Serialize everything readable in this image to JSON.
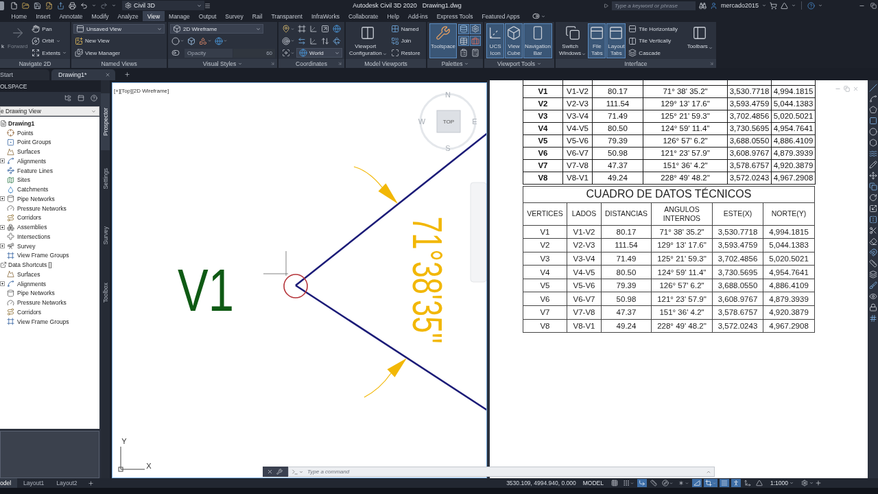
{
  "title_bar": {
    "workspace": "Civil 3D",
    "title": "Autodesk Civil 3D 2020",
    "file_name": "Drawing1.dwg",
    "search": {
      "placeholder": "Type a keyword or phrase"
    },
    "user": "mercado2015"
  },
  "ribbon_tabs": [
    {
      "label": "Home",
      "selected": false
    },
    {
      "label": "Insert",
      "selected": false
    },
    {
      "label": "Annotate",
      "selected": false
    },
    {
      "label": "Modify",
      "selected": false
    },
    {
      "label": "Analyze",
      "selected": false
    },
    {
      "label": "View",
      "selected": true
    },
    {
      "label": "Manage",
      "selected": false
    },
    {
      "label": "Output",
      "selected": false
    },
    {
      "label": "Survey",
      "selected": false
    },
    {
      "label": "Rail",
      "selected": false
    },
    {
      "label": "Transparent",
      "selected": false
    },
    {
      "label": "InfraWorks",
      "selected": false
    },
    {
      "label": "Collaborate",
      "selected": false
    },
    {
      "label": "Help",
      "selected": false
    },
    {
      "label": "Add-ins",
      "selected": false
    },
    {
      "label": "Express Tools",
      "selected": false
    },
    {
      "label": "Featured Apps",
      "selected": false
    }
  ],
  "ribbon_panels": [
    {
      "title": "Navigate 2D",
      "menu": false,
      "launcher": false,
      "groups": [
        {
          "kind": "large",
          "items": [
            {
              "label": "k",
              "disabled": false,
              "selected": false,
              "menu": false
            },
            {
              "label": "Forward",
              "disabled": true,
              "selected": false,
              "menu": false
            }
          ]
        },
        {
          "kind": "stack",
          "rows": [
            [
              {
                "kind": "small",
                "label": "Pan",
                "menu": false
              }
            ],
            [
              {
                "kind": "small",
                "label": "Orbit",
                "menu": true
              }
            ],
            [
              {
                "kind": "small",
                "label": "Extents",
                "menu": true
              }
            ]
          ]
        }
      ]
    },
    {
      "title": "Named Views",
      "menu": false,
      "launcher": false,
      "groups": [
        {
          "kind": "stack",
          "rows": [
            [
              {
                "kind": "dropdown",
                "value": "Unsaved View"
              }
            ],
            [
              {
                "kind": "small",
                "label": "New View",
                "menu": false
              }
            ],
            [
              {
                "kind": "small",
                "label": "View Manager",
                "menu": false
              }
            ]
          ]
        }
      ]
    },
    {
      "title": "Visual Styles",
      "menu": true,
      "launcher": true,
      "groups": [
        {
          "kind": "stack",
          "rows": [
            [
              {
                "kind": "dropdown",
                "value": "2D Wireframe"
              }
            ],
            [
              {
                "kind": "icon",
                "menu": true,
                "selected": false
              },
              {
                "kind": "icon",
                "menu": false,
                "selected": false
              },
              {
                "kind": "icon",
                "menu": true,
                "selected": false
              },
              {
                "kind": "icon",
                "menu": true,
                "selected": false
              }
            ],
            [
              {
                "kind": "icon",
                "menu": false,
                "selected": false
              },
              {
                "kind": "slider",
                "label": "Opacity",
                "value": "60",
                "disabled": true
              }
            ]
          ]
        }
      ]
    },
    {
      "title": "Coordinates",
      "menu": false,
      "launcher": true,
      "groups": [
        {
          "kind": "stack",
          "rows": [
            [
              {
                "kind": "icon",
                "menu": true,
                "selected": false
              },
              {
                "kind": "icon",
                "menu": false,
                "selected": false
              },
              {
                "kind": "icon",
                "menu": false,
                "selected": false
              },
              {
                "kind": "icon",
                "menu": false,
                "selected": false
              },
              {
                "kind": "icon",
                "menu": false,
                "selected": false
              }
            ],
            [
              {
                "kind": "icon",
                "menu": true,
                "selected": false
              },
              {
                "kind": "icon",
                "menu": false,
                "selected": false
              },
              {
                "kind": "icon",
                "menu": false,
                "selected": false
              },
              {
                "kind": "icon",
                "menu": false,
                "selected": false
              },
              {
                "kind": "icon",
                "menu": false,
                "selected": false
              }
            ],
            [
              {
                "kind": "icon",
                "menu": true,
                "selected": false
              },
              {
                "kind": "dropdown",
                "value": "World"
              }
            ]
          ]
        }
      ]
    },
    {
      "title": "Model Viewports",
      "menu": false,
      "launcher": false,
      "groups": [
        {
          "kind": "large",
          "items": [
            {
              "label": "Viewport Configuration",
              "disabled": false,
              "selected": false,
              "menu": true
            }
          ]
        },
        {
          "kind": "stack",
          "rows": [
            [
              {
                "kind": "small",
                "label": "Named",
                "menu": false
              }
            ],
            [
              {
                "kind": "small",
                "label": "Join",
                "menu": false
              }
            ],
            [
              {
                "kind": "small",
                "label": "Restore",
                "menu": false
              }
            ]
          ]
        }
      ]
    },
    {
      "title": "Palettes",
      "menu": true,
      "launcher": false,
      "groups": [
        {
          "kind": "large",
          "items": [
            {
              "label": "Toolspace",
              "disabled": false,
              "selected": true,
              "menu": false
            }
          ]
        },
        {
          "kind": "stack",
          "rows": [
            [
              {
                "kind": "icon",
                "menu": false,
                "selected": true
              },
              {
                "kind": "icon",
                "menu": false,
                "selected": true
              }
            ],
            [
              {
                "kind": "icon",
                "menu": false,
                "selected": true
              },
              {
                "kind": "icon",
                "menu": false,
                "selected": true
              }
            ],
            [
              {
                "kind": "icon",
                "menu": false,
                "selected": false
              },
              {
                "kind": "icon",
                "menu": false,
                "selected": false
              }
            ]
          ]
        }
      ]
    },
    {
      "title": "Viewport Tools",
      "menu": true,
      "launcher": false,
      "groups": [
        {
          "kind": "large",
          "items": [
            {
              "label": "UCS Icon",
              "disabled": false,
              "selected": true,
              "menu": false
            },
            {
              "label": "View Cube",
              "disabled": false,
              "selected": true,
              "menu": false
            },
            {
              "label": "Navigation Bar",
              "disabled": false,
              "selected": true,
              "menu": false
            }
          ]
        }
      ]
    },
    {
      "title": "Interface",
      "menu": false,
      "launcher": true,
      "groups": [
        {
          "kind": "large",
          "items": [
            {
              "label": "Switch Windows",
              "disabled": false,
              "selected": false,
              "menu": true
            },
            {
              "label": "File Tabs",
              "disabled": false,
              "selected": true,
              "menu": false
            },
            {
              "label": "Layout Tabs",
              "disabled": false,
              "selected": true,
              "menu": false
            }
          ]
        },
        {
          "kind": "stack",
          "rows": [
            [
              {
                "kind": "small",
                "label": "Tile Horizontally",
                "menu": false
              }
            ],
            [
              {
                "kind": "small",
                "label": "Tile Vertically",
                "menu": false
              }
            ],
            [
              {
                "kind": "small",
                "label": "Cascade",
                "menu": false
              }
            ]
          ]
        },
        {
          "kind": "large",
          "items": [
            {
              "label": "Toolbars",
              "disabled": false,
              "selected": false,
              "menu": true
            }
          ]
        }
      ]
    }
  ],
  "file_tabs": [
    {
      "label": "Start",
      "selected": false,
      "closable": false
    },
    {
      "label": "Drawing1*",
      "selected": true,
      "closable": true
    }
  ],
  "toolspace": {
    "title": "OLSPACE",
    "view": "e Drawing View",
    "tree": [
      {
        "label": "Drawing1",
        "current": true,
        "children": [
          {
            "label": "Points",
            "collapsed": false
          },
          {
            "label": "Point Groups",
            "collapsed": false
          },
          {
            "label": "Surfaces",
            "collapsed": false
          },
          {
            "label": "Alignments",
            "collapsed": true
          },
          {
            "label": "Feature Lines",
            "collapsed": false
          },
          {
            "label": "Sites",
            "collapsed": false
          },
          {
            "label": "Catchments",
            "collapsed": false
          },
          {
            "label": "Pipe Networks",
            "collapsed": true
          },
          {
            "label": "Pressure Networks",
            "collapsed": false
          },
          {
            "label": "Corridors",
            "collapsed": false
          },
          {
            "label": "Assemblies",
            "collapsed": true
          },
          {
            "label": "Intersections",
            "collapsed": false
          },
          {
            "label": "Survey",
            "collapsed": true
          },
          {
            "label": "View Frame Groups",
            "collapsed": false
          }
        ]
      },
      {
        "label": "Data Shortcuts []",
        "current": false,
        "children": [
          {
            "label": "Surfaces",
            "collapsed": false
          },
          {
            "label": "Alignments",
            "collapsed": true
          },
          {
            "label": "Pipe Networks",
            "collapsed": false
          },
          {
            "label": "Pressure Networks",
            "collapsed": false
          },
          {
            "label": "Corridors",
            "collapsed": false
          },
          {
            "label": "View Frame Groups",
            "collapsed": false
          }
        ]
      }
    ],
    "tabs": [
      {
        "label": "Prospector",
        "selected": true
      },
      {
        "label": "Settings",
        "selected": false
      },
      {
        "label": "Survey",
        "selected": false
      },
      {
        "label": "Toolbox",
        "selected": false
      }
    ]
  },
  "viewport_left": {
    "label": "[+][Top][2D Wireframe]",
    "active": true,
    "view_cube": {
      "north": "N",
      "west": "W",
      "east": "E",
      "south": "S",
      "face": "TOP"
    },
    "ucs": {
      "y": "Y",
      "x": "X"
    },
    "drawing": {
      "vertex_label": "V1",
      "angle_label": "71°38'35\""
    }
  },
  "viewport_right": {
    "top_table": {
      "rows": [
        [
          "V1",
          "V1-V2",
          "80.17",
          "71° 38' 35.2\"",
          "3,530.7718",
          "4,994.1815"
        ],
        [
          "V2",
          "V2-V3",
          "111.54",
          "129° 13' 17.6\"",
          "3,593.4759",
          "5,044.1383"
        ],
        [
          "V3",
          "V3-V4",
          "71.49",
          "125° 21' 59.3\"",
          "3,702.4856",
          "5,020.5021"
        ],
        [
          "V4",
          "V4-V5",
          "80.50",
          "124° 59' 11.4\"",
          "3,730.5695",
          "4,954.7641"
        ],
        [
          "V5",
          "V5-V6",
          "79.39",
          "126° 57' 6.2\"",
          "3,688.0550",
          "4,886.4109"
        ],
        [
          "V6",
          "V6-V7",
          "50.98",
          "121° 23' 57.9\"",
          "3,608.9767",
          "4,879.3939"
        ],
        [
          "V7",
          "V7-V8",
          "47.37",
          "151° 36' 4.2\"",
          "3,578.6757",
          "4,920.3879"
        ],
        [
          "V8",
          "V8-V1",
          "49.24",
          "228° 49' 48.2\"",
          "3,572.0243",
          "4,967.2908"
        ]
      ]
    },
    "table": {
      "title": "CUADRO DE DATOS TÉCNICOS",
      "columns": [
        "VERTICES",
        "LADOS",
        "DISTANCIAS",
        "ANGULOS INTERNOS",
        "ESTE(X)",
        "NORTE(Y)"
      ],
      "rows": [
        [
          "V1",
          "V1-V2",
          "80.17",
          "71° 38' 35.2\"",
          "3,530.7718",
          "4,994.1815"
        ],
        [
          "V2",
          "V2-V3",
          "111.54",
          "129° 13' 17.6\"",
          "3,593.4759",
          "5,044.1383"
        ],
        [
          "V3",
          "V3-V4",
          "71.49",
          "125° 21' 59.3\"",
          "3,702.4856",
          "5,020.5021"
        ],
        [
          "V4",
          "V4-V5",
          "80.50",
          "124° 59' 11.4\"",
          "3,730.5695",
          "4,954.7641"
        ],
        [
          "V5",
          "V5-V6",
          "79.39",
          "126° 57' 6.2\"",
          "3,688.0550",
          "4,886.4109"
        ],
        [
          "V6",
          "V6-V7",
          "50.98",
          "121° 23' 57.9\"",
          "3,608.9767",
          "4,879.3939"
        ],
        [
          "V7",
          "V7-V8",
          "47.37",
          "151° 36' 4.2\"",
          "3,578.6757",
          "4,920.3879"
        ],
        [
          "V8",
          "V8-V1",
          "49.24",
          "228° 49' 48.2\"",
          "3,572.0243",
          "4,967.2908"
        ]
      ]
    }
  },
  "command_line": {
    "placeholder": "Type a command"
  },
  "status_bar": {
    "layouts": [
      {
        "label": "odel",
        "selected": true
      },
      {
        "label": "Layout1",
        "selected": false
      },
      {
        "label": "Layout2",
        "selected": false
      }
    ],
    "coordinates": "3530.109, 4994.940, 0.000",
    "space": "MODEL",
    "tools": [
      {
        "on": false,
        "menu": false
      },
      {
        "on": false,
        "menu": true
      },
      {
        "on": true,
        "menu": false
      },
      {
        "on": false,
        "menu": false
      },
      {
        "on": false,
        "menu": true
      },
      {
        "on": false,
        "menu": true
      },
      {
        "on": true,
        "menu": false
      },
      {
        "on": true,
        "menu": true
      },
      {
        "on": true,
        "menu": false
      },
      {
        "on": true,
        "menu": false
      },
      {
        "on": false,
        "menu": false
      },
      {
        "on": false,
        "menu": false
      }
    ],
    "scale": "1:1000"
  }
}
